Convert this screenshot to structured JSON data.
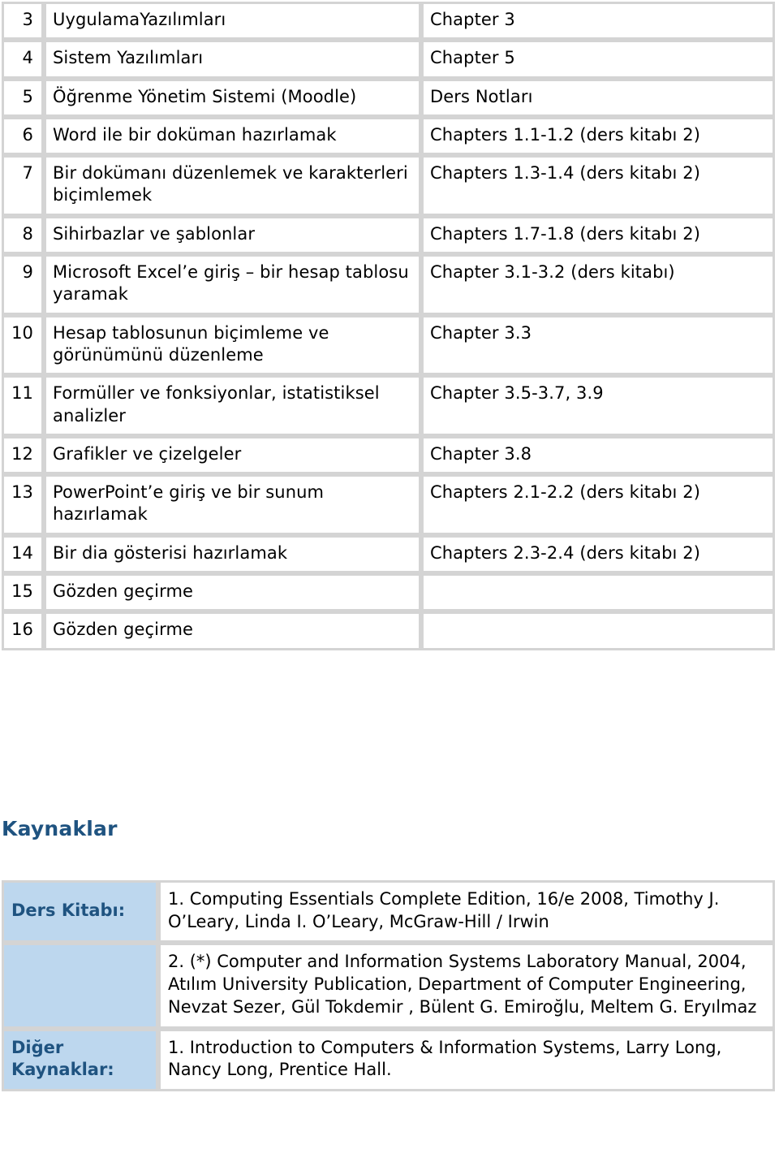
{
  "colors": {
    "heading_blue": "#1f5380",
    "label_cell_bg": "#bdd7ee",
    "table_border": "#d4d4d4",
    "text": "#000000",
    "page_bg": "#ffffff"
  },
  "syllabus_table": {
    "name": "weekly-course-schedule",
    "rows": [
      {
        "week": "3",
        "topic": "UygulamaYazılımları",
        "reference": "Chapter 3"
      },
      {
        "week": "4",
        "topic": "Sistem Yazılımları",
        "reference": "Chapter 5"
      },
      {
        "week": "5",
        "topic": "Öğrenme Yönetim Sistemi (Moodle)",
        "reference": "Ders Notları"
      },
      {
        "week": "6",
        "topic": "Word ile bir doküman hazırlamak",
        "reference": "Chapters 1.1-1.2 (ders kitabı 2)"
      },
      {
        "week": "7",
        "topic": "Bir dokümanı düzenlemek ve karakterleri biçimlemek",
        "reference": "Chapters 1.3-1.4 (ders kitabı 2)"
      },
      {
        "week": "8",
        "topic": "Sihirbazlar ve şablonlar",
        "reference": "Chapters 1.7-1.8 (ders kitabı 2)"
      },
      {
        "week": "9",
        "topic": "Microsoft Excel’e giriş – bir hesap tablosu yaramak",
        "reference": "Chapter 3.1-3.2 (ders kitabı)"
      },
      {
        "week": "10",
        "topic": "Hesap tablosunun biçimleme ve görünümünü düzenleme",
        "reference": "Chapter 3.3"
      },
      {
        "week": "11",
        "topic": "Formüller ve fonksiyonlar, istatistiksel analizler",
        "reference": "Chapter 3.5-3.7, 3.9"
      },
      {
        "week": "12",
        "topic": "Grafikler ve çizelgeler",
        "reference": "Chapter 3.8"
      },
      {
        "week": "13",
        "topic": "PowerPoint’e giriş ve bir sunum hazırlamak",
        "reference": "Chapters 2.1-2.2 (ders kitabı 2)"
      },
      {
        "week": "14",
        "topic": "Bir dia gösterisi hazırlamak",
        "reference": "Chapters 2.3-2.4 (ders kitabı 2)"
      },
      {
        "week": "15",
        "topic": "Gözden geçirme",
        "reference": ""
      },
      {
        "week": "16",
        "topic": "Gözden geçirme",
        "reference": ""
      }
    ]
  },
  "resources_section": {
    "heading": "Kaynaklar",
    "rows": [
      {
        "label": "Ders Kitabı:",
        "text": "1. Computing Essentials Complete Edition, 16/e 2008, Timothy J. O’Leary, Linda I. O’Leary, McGraw-Hill / Irwin"
      },
      {
        "label": "",
        "text": "2. (*) Computer and Information Systems Laboratory Manual, 2004, Atılım University Publication, Department of Computer Engineering, Nevzat Sezer, Gül Tokdemir , Bülent G. Emiroğlu, Meltem G. Eryılmaz"
      },
      {
        "label": "Diğer Kaynaklar:",
        "text": "1. Introduction to Computers & Information Systems, Larry Long, Nancy Long, Prentice Hall."
      }
    ]
  }
}
